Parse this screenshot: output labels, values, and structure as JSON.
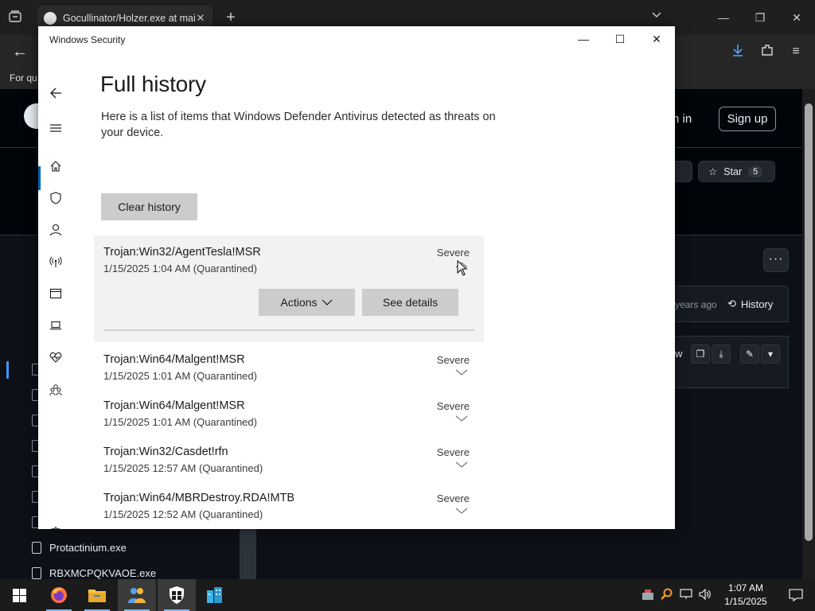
{
  "browser": {
    "tab_title": "Gocullinator/Holzer.exe at mair",
    "tab_close": "✕",
    "new_tab": "+",
    "bookmarks_text": "For qu",
    "sign_in": "n in",
    "sign_up": "Sign up",
    "star_label": "Star",
    "star_count": "5",
    "more_label": "···",
    "commit_age": "years ago",
    "history_label": "History",
    "file_toolbar_w": "w",
    "files": [
      "Protactinium.exe",
      "RBXMCPQKVAOE.exe"
    ]
  },
  "window": {
    "title": "Windows Security",
    "minimize": "—",
    "maximize": "☐",
    "close": "✕"
  },
  "nav": {
    "back_icon": "back-arrow-icon",
    "items": [
      "menu-icon",
      "home-icon",
      "shield-icon",
      "account-icon",
      "firewall-icon",
      "app-browser-icon",
      "device-security-icon",
      "device-health-icon",
      "family-icon",
      "settings-icon"
    ],
    "selected": "shield-icon"
  },
  "page": {
    "heading": "Full history",
    "description": "Here is a list of items that Windows Defender Antivirus detected as threats on your device.",
    "clear_history": "Clear history",
    "actions_label": "Actions",
    "see_details": "See details"
  },
  "threats": [
    {
      "name": "Trojan:Win32/AgentTesla!MSR",
      "date": "1/15/2025 1:04 AM (Quarantined)",
      "severity": "Severe",
      "expanded": true
    },
    {
      "name": "Trojan:Win64/Malgent!MSR",
      "date": "1/15/2025 1:01 AM (Quarantined)",
      "severity": "Severe",
      "expanded": false
    },
    {
      "name": "Trojan:Win64/Malgent!MSR",
      "date": "1/15/2025 1:01 AM (Quarantined)",
      "severity": "Severe",
      "expanded": false
    },
    {
      "name": "Trojan:Win32/Casdet!rfn",
      "date": "1/15/2025 12:57 AM (Quarantined)",
      "severity": "Severe",
      "expanded": false
    },
    {
      "name": "Trojan:Win64/MBRDestroy.RDA!MTB",
      "date": "1/15/2025 12:52 AM (Quarantined)",
      "severity": "Severe",
      "expanded": false
    }
  ],
  "taskbar": {
    "apps": [
      "start-icon",
      "firefox-icon",
      "file-explorer-icon",
      "people-app-icon",
      "windows-security-icon",
      "buildings-app-icon"
    ],
    "time": "1:07 AM",
    "date": "1/15/2025"
  },
  "colors": {
    "accent": "#0063b1",
    "button_gray": "#cccccc",
    "expanded_bg": "#f2f2f2"
  }
}
